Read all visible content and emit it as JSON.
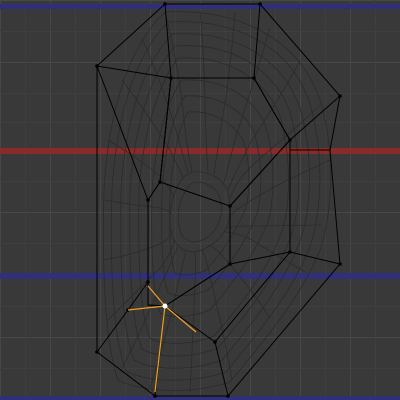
{
  "viewport": {
    "mode": "edit-mode",
    "shading": "wireframe",
    "selected_vertex_count": 1
  },
  "colors": {
    "background": "#393939",
    "grid": "#474747",
    "grid_major": "#505050",
    "x_axis": "#8a2b2b",
    "y_axis": "#2f2f7a",
    "cage_edge": "#000000",
    "cage_vertex": "#000000",
    "subdiv_wire": "#2a2a2a",
    "selected_vertex": "#ffffff",
    "selected_edge": "#f0a020"
  }
}
